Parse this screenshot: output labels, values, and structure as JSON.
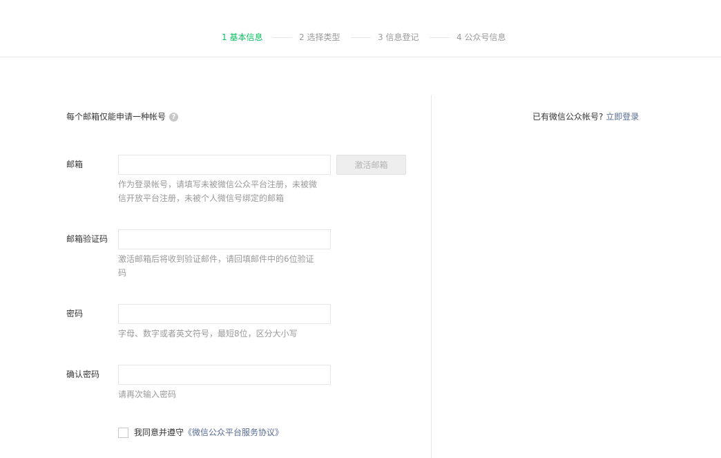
{
  "steps": [
    {
      "label": "1 基本信息",
      "active": true
    },
    {
      "label": "2 选择类型",
      "active": false
    },
    {
      "label": "3 信息登记",
      "active": false
    },
    {
      "label": "4 公众号信息",
      "active": false
    }
  ],
  "notice": {
    "text": "每个邮箱仅能申请一种帐号",
    "help_icon": "?"
  },
  "login_tip": {
    "text": "已有微信公众帐号?",
    "link": "立即登录"
  },
  "form": {
    "email": {
      "label": "邮箱",
      "value": "",
      "placeholder": "",
      "button": "激活邮箱",
      "hint": "作为登录帐号，请填写未被微信公众平台注册，未被微信开放平台注册，未被个人微信号绑定的邮箱"
    },
    "code": {
      "label": "邮箱验证码",
      "value": "",
      "placeholder": "",
      "hint": "激活邮箱后将收到验证邮件，请回填邮件中的6位验证码"
    },
    "password": {
      "label": "密码",
      "value": "",
      "placeholder": "",
      "hint": "字母、数字或者英文符号，最短8位，区分大小写"
    },
    "confirm": {
      "label": "确认密码",
      "value": "",
      "placeholder": "",
      "hint": "请再次输入密码"
    }
  },
  "agreement": {
    "prefix": "我同意并遵守",
    "link": "《微信公众平台服务协议》",
    "checked": false
  },
  "colors": {
    "accent": "#07c160",
    "link": "#576b95",
    "hint": "#9a9a9a",
    "border": "#e7e7eb"
  }
}
